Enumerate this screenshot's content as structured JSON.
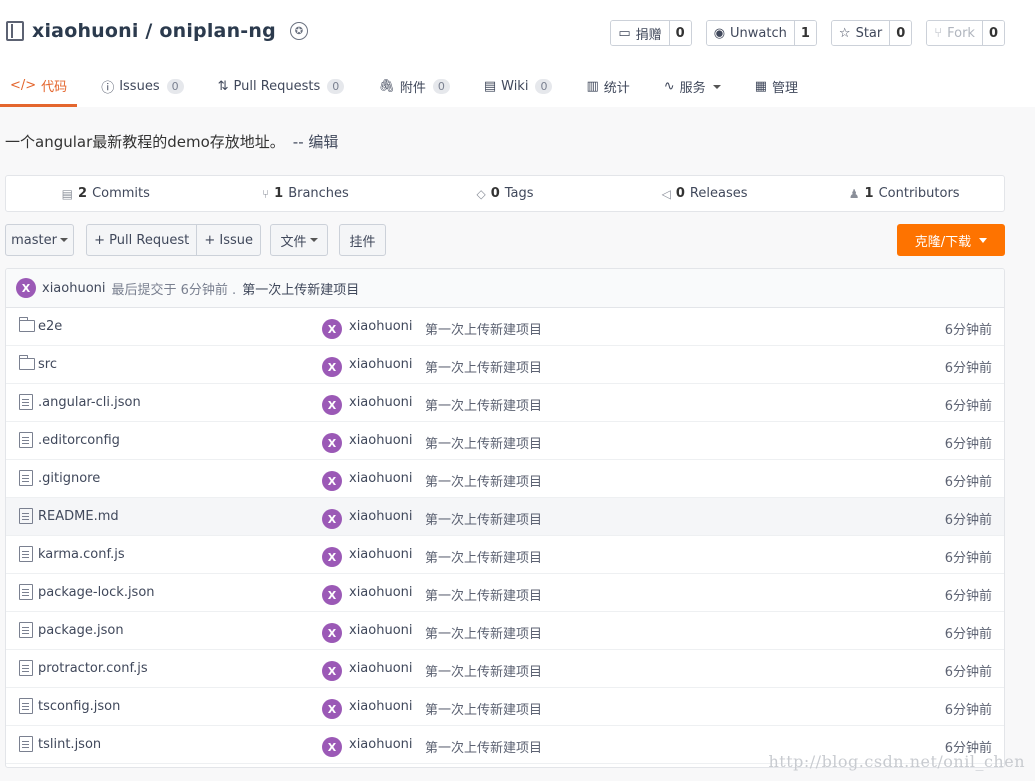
{
  "repo": {
    "title": "xiaohuoni / oniplan-ng",
    "badge_icon": "badge-icon"
  },
  "actions": [
    {
      "label": "捐赠",
      "count": "0",
      "icon": "donate-icon"
    },
    {
      "label": "Unwatch",
      "count": "1",
      "icon": "eye-icon"
    },
    {
      "label": "Star",
      "count": "0",
      "icon": "star-icon"
    },
    {
      "label": "Fork",
      "count": "0",
      "icon": "fork-icon"
    }
  ],
  "tabs": [
    {
      "label": "代码",
      "icon": "</>"
    },
    {
      "label": "Issues",
      "count": "0",
      "icon": "ⓘ"
    },
    {
      "label": "Pull Requests",
      "count": "0",
      "icon": "⇅"
    },
    {
      "label": "附件",
      "count": "0",
      "icon": "🖇"
    },
    {
      "label": "Wiki",
      "count": "0",
      "icon": "▤"
    },
    {
      "label": "统计",
      "icon": "▥"
    },
    {
      "label": "服务",
      "icon": "∿"
    },
    {
      "label": "管理",
      "icon": "▦"
    }
  ],
  "description": {
    "text": "一个angular最新教程的demo存放地址。",
    "edit": "-- 编辑"
  },
  "stats": [
    {
      "count": "2",
      "label": "Commits",
      "icon": "▤"
    },
    {
      "count": "1",
      "label": "Branches",
      "icon": "⑂"
    },
    {
      "count": "0",
      "label": "Tags",
      "icon": "◇"
    },
    {
      "count": "0",
      "label": "Releases",
      "icon": "◁"
    },
    {
      "count": "1",
      "label": "Contributors",
      "icon": "♟"
    }
  ],
  "toolbar": {
    "branch": "master",
    "pull_request": "+ Pull Request",
    "issue": "+ Issue",
    "files": "文件",
    "widget": "挂件",
    "clone": "克隆/下载"
  },
  "last_commit": {
    "avatar": "X",
    "author": "xiaohuoni",
    "meta": "最后提交于 6分钟前 .",
    "message": "第一次上传新建项目"
  },
  "files": [
    {
      "name": "e2e",
      "type": "folder",
      "avatar": "X",
      "author": "xiaohuoni",
      "message": "第一次上传新建项目",
      "time": "6分钟前"
    },
    {
      "name": "src",
      "type": "folder",
      "avatar": "X",
      "author": "xiaohuoni",
      "message": "第一次上传新建项目",
      "time": "6分钟前"
    },
    {
      "name": ".angular-cli.json",
      "type": "file",
      "avatar": "X",
      "author": "xiaohuoni",
      "message": "第一次上传新建项目",
      "time": "6分钟前"
    },
    {
      "name": ".editorconfig",
      "type": "file",
      "avatar": "X",
      "author": "xiaohuoni",
      "message": "第一次上传新建项目",
      "time": "6分钟前"
    },
    {
      "name": ".gitignore",
      "type": "file",
      "avatar": "X",
      "author": "xiaohuoni",
      "message": "第一次上传新建项目",
      "time": "6分钟前"
    },
    {
      "name": "README.md",
      "type": "file",
      "avatar": "X",
      "author": "xiaohuoni",
      "message": "第一次上传新建项目",
      "time": "6分钟前"
    },
    {
      "name": "karma.conf.js",
      "type": "file",
      "avatar": "X",
      "author": "xiaohuoni",
      "message": "第一次上传新建项目",
      "time": "6分钟前"
    },
    {
      "name": "package-lock.json",
      "type": "file",
      "avatar": "X",
      "author": "xiaohuoni",
      "message": "第一次上传新建项目",
      "time": "6分钟前"
    },
    {
      "name": "package.json",
      "type": "file",
      "avatar": "X",
      "author": "xiaohuoni",
      "message": "第一次上传新建项目",
      "time": "6分钟前"
    },
    {
      "name": "protractor.conf.js",
      "type": "file",
      "avatar": "X",
      "author": "xiaohuoni",
      "message": "第一次上传新建项目",
      "time": "6分钟前"
    },
    {
      "name": "tsconfig.json",
      "type": "file",
      "avatar": "X",
      "author": "xiaohuoni",
      "message": "第一次上传新建项目",
      "time": "6分钟前"
    },
    {
      "name": "tslint.json",
      "type": "file",
      "avatar": "X",
      "author": "xiaohuoni",
      "message": "第一次上传新建项目",
      "time": "6分钟前"
    }
  ],
  "watermark": "http://blog.csdn.net/onil_chen",
  "colors": {
    "accent": "#e4662e",
    "clone_button": "#fe7300",
    "avatar": "#9b59b6"
  }
}
